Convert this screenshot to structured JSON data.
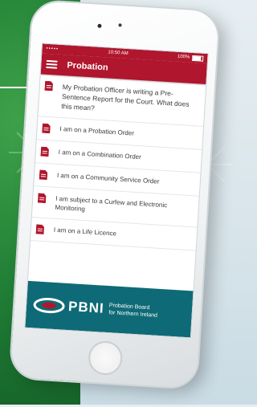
{
  "status_bar": {
    "signal": "•••••",
    "time": "10:50 AM",
    "battery": "100%"
  },
  "header": {
    "title": "Probation"
  },
  "items": [
    {
      "label": "My Probation Officer is writing a Pre-Sentence Report for the Court. What does this mean?"
    },
    {
      "label": "I am on a Probation Order"
    },
    {
      "label": "I am on a Combination Order"
    },
    {
      "label": "I am on a Community Service Order"
    },
    {
      "label": "I am subject to a Curfew and Electronic Monitoring"
    },
    {
      "label": "I am on a Life Licence"
    }
  ],
  "footer": {
    "brand": "PBNI",
    "subtitle_line1": "Probation Board",
    "subtitle_line2": "for Northern Ireland"
  },
  "colors": {
    "accent": "#b0162d",
    "footer": "#0e6a76",
    "background_green": "#1f7d35"
  }
}
